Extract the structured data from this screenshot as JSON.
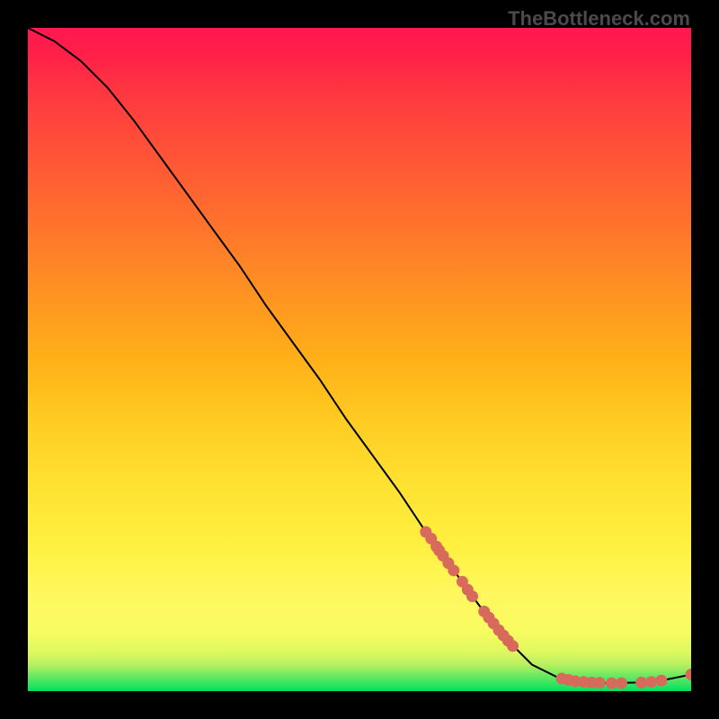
{
  "watermark": "TheBottleneck.com",
  "chart_data": {
    "type": "line",
    "title": "",
    "xlabel": "",
    "ylabel": "",
    "xlim": [
      0,
      100
    ],
    "ylim": [
      0,
      100
    ],
    "series": [
      {
        "name": "curve",
        "x": [
          0,
          4,
          8,
          12,
          16,
          20,
          24,
          28,
          32,
          36,
          40,
          44,
          48,
          52,
          56,
          60,
          64,
          68,
          72,
          76,
          80,
          84,
          88,
          92,
          96,
          100
        ],
        "values": [
          100,
          98,
          95,
          91,
          86,
          80.5,
          75,
          69.5,
          64,
          58,
          52.5,
          47,
          41,
          35.5,
          30,
          24,
          18.5,
          13,
          8,
          4,
          2,
          1.3,
          1.2,
          1.3,
          1.7,
          2.5
        ]
      }
    ],
    "markers": [
      {
        "x": 60.0,
        "y": 24.0
      },
      {
        "x": 60.8,
        "y": 23.0
      },
      {
        "x": 61.6,
        "y": 21.8
      },
      {
        "x": 62.0,
        "y": 21.2
      },
      {
        "x": 62.6,
        "y": 20.4
      },
      {
        "x": 63.4,
        "y": 19.3
      },
      {
        "x": 64.2,
        "y": 18.2
      },
      {
        "x": 65.5,
        "y": 16.5
      },
      {
        "x": 66.3,
        "y": 15.3
      },
      {
        "x": 67.0,
        "y": 14.3
      },
      {
        "x": 68.8,
        "y": 12.0
      },
      {
        "x": 69.5,
        "y": 11.1
      },
      {
        "x": 70.2,
        "y": 10.2
      },
      {
        "x": 71.0,
        "y": 9.2
      },
      {
        "x": 71.7,
        "y": 8.4
      },
      {
        "x": 72.4,
        "y": 7.6
      },
      {
        "x": 73.1,
        "y": 6.8
      },
      {
        "x": 80.5,
        "y": 1.9
      },
      {
        "x": 81.5,
        "y": 1.7
      },
      {
        "x": 82.5,
        "y": 1.5
      },
      {
        "x": 83.8,
        "y": 1.4
      },
      {
        "x": 85.0,
        "y": 1.3
      },
      {
        "x": 86.2,
        "y": 1.25
      },
      {
        "x": 88.0,
        "y": 1.2
      },
      {
        "x": 89.5,
        "y": 1.2
      },
      {
        "x": 92.5,
        "y": 1.3
      },
      {
        "x": 94.0,
        "y": 1.4
      },
      {
        "x": 95.5,
        "y": 1.6
      },
      {
        "x": 100.0,
        "y": 2.5
      }
    ],
    "marker_color": "#d86a5c",
    "curve_color": "#000000"
  }
}
